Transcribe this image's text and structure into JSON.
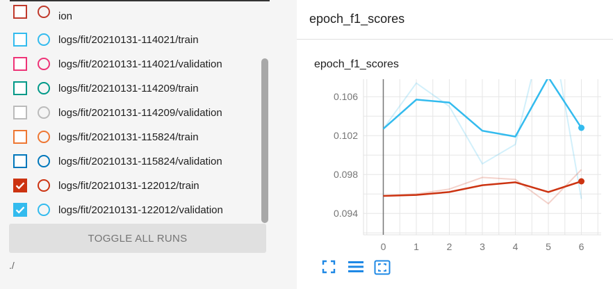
{
  "sidebar": {
    "runs": [
      {
        "label": "ion",
        "checked": false,
        "color": "#c0392b"
      },
      {
        "label": "logs/fit/20210131-114021/train",
        "checked": false,
        "color": "#33bbee"
      },
      {
        "label": "logs/fit/20210131-114021/validation",
        "checked": false,
        "color": "#ee3377"
      },
      {
        "label": "logs/fit/20210131-114209/train",
        "checked": false,
        "color": "#009988"
      },
      {
        "label": "logs/fit/20210131-114209/validation",
        "checked": false,
        "color": "#bbbbbb"
      },
      {
        "label": "logs/fit/20210131-115824/train",
        "checked": false,
        "color": "#ee7733"
      },
      {
        "label": "logs/fit/20210131-115824/validation",
        "checked": false,
        "color": "#0077bb"
      },
      {
        "label": "logs/fit/20210131-122012/train",
        "checked": true,
        "color": "#cc3311"
      },
      {
        "label": "logs/fit/20210131-122012/validation",
        "checked": true,
        "color": "#33bbee"
      }
    ],
    "toggle_label": "TOGGLE ALL RUNS",
    "logdir": "./"
  },
  "card": {
    "title": "epoch_f1_scores",
    "chart_title": "epoch_f1_scores"
  },
  "chart_data": {
    "type": "line",
    "title": "epoch_f1_scores",
    "x": [
      0,
      1,
      2,
      3,
      4,
      5,
      6
    ],
    "xlim": [
      -0.6,
      6.6
    ],
    "ylim": [
      0.0918,
      0.1078
    ],
    "yticks": [
      0.094,
      0.098,
      0.102,
      0.106
    ],
    "ytick_labels": [
      "0.094",
      "0.098",
      "0.102",
      "0.106"
    ],
    "xtick_labels": [
      "0",
      "1",
      "2",
      "3",
      "4",
      "5",
      "6"
    ],
    "grid": true,
    "series": [
      {
        "color": "#33bbee",
        "smoothed": [
          0.1027,
          0.1057,
          0.1054,
          0.1025,
          0.1019,
          0.108,
          0.1028
        ],
        "raw": [
          0.1027,
          0.1074,
          0.105,
          0.0991,
          0.1011,
          0.115,
          0.0955
        ]
      },
      {
        "color": "#cc3311",
        "smoothed": [
          0.0958,
          0.0959,
          0.0962,
          0.0969,
          0.0972,
          0.0962,
          0.0973
        ],
        "raw": [
          0.0958,
          0.096,
          0.0965,
          0.0977,
          0.0975,
          0.095,
          0.0985
        ]
      }
    ]
  }
}
